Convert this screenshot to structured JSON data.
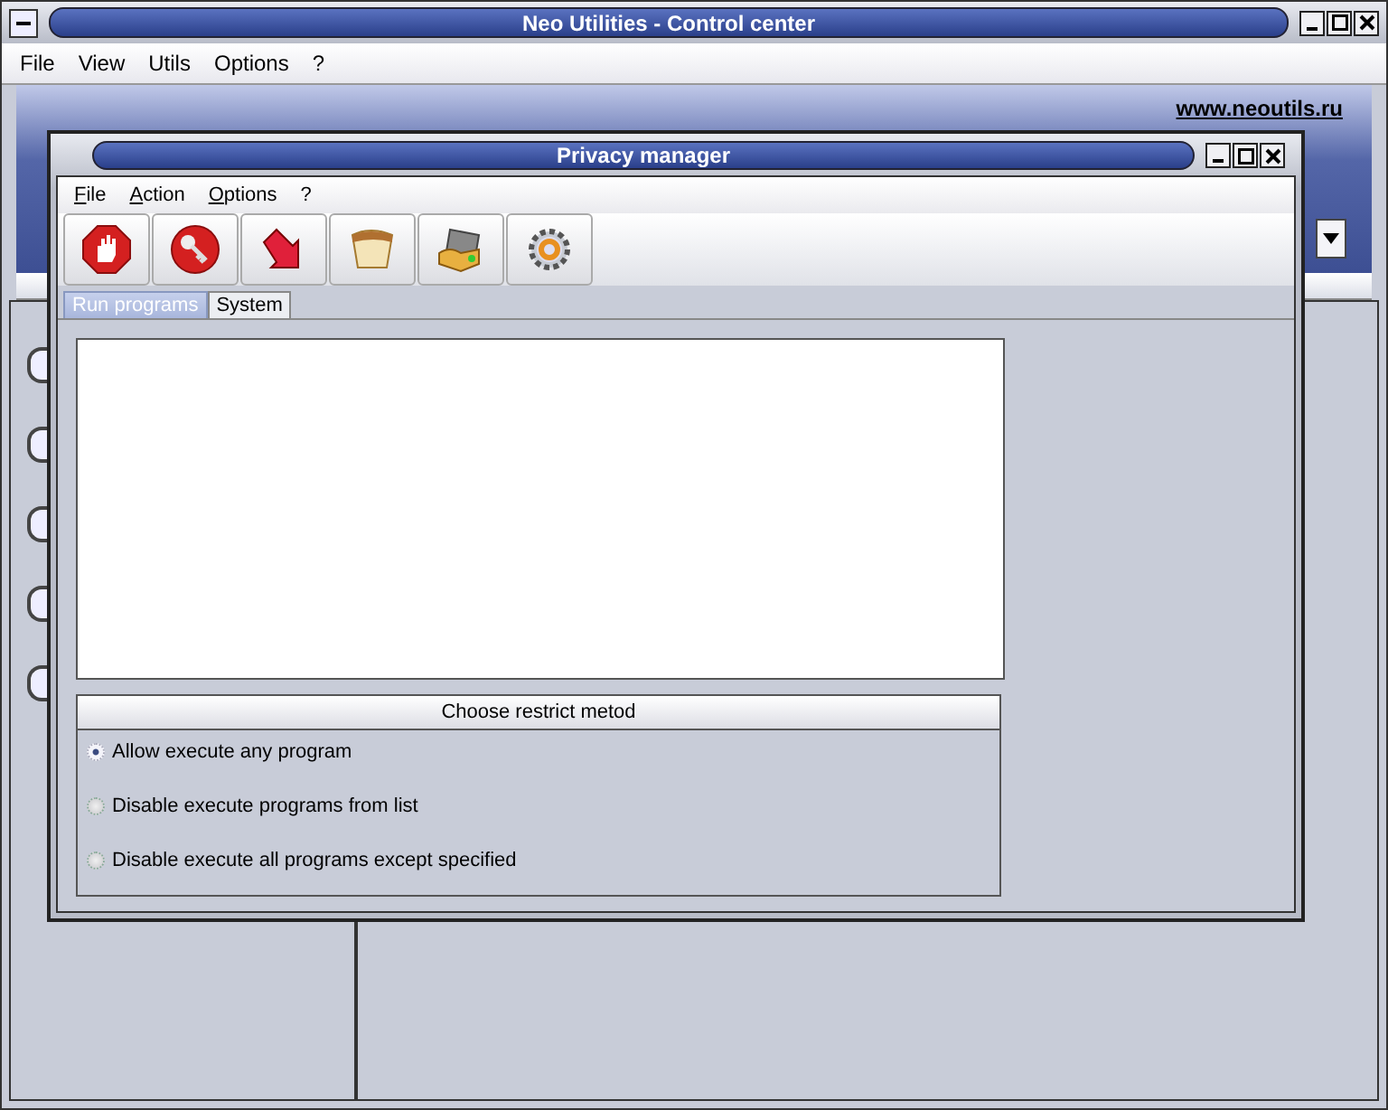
{
  "main_window": {
    "title": "Neo Utilities - Control center",
    "menu": [
      "File",
      "View",
      "Utils",
      "Options",
      "?"
    ],
    "website_link": "www.neoutils.ru"
  },
  "privacy_window": {
    "title": "Privacy manager",
    "menu": [
      "File",
      "Action",
      "Options",
      "?"
    ],
    "tabs": [
      {
        "label": "Run programs",
        "selected": true
      },
      {
        "label": "System",
        "selected": false
      }
    ],
    "restrict_group": {
      "title": "Choose restrict metod",
      "options": [
        {
          "label": "Allow execute any program",
          "selected": true
        },
        {
          "label": "Disable execute programs from list",
          "selected": false
        },
        {
          "label": "Disable execute all programs except specified",
          "selected": false
        }
      ]
    }
  }
}
